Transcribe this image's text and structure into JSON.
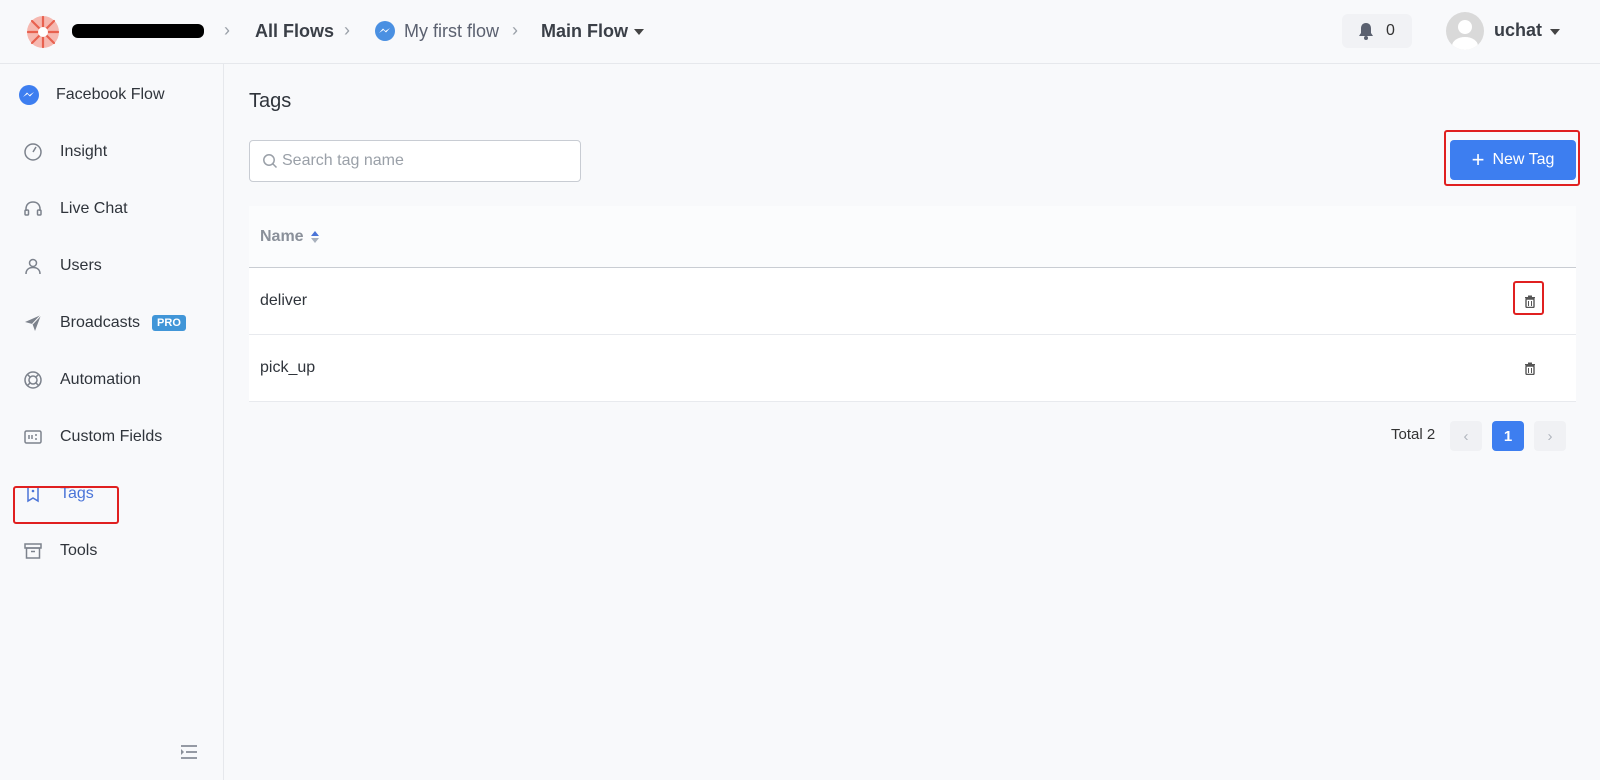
{
  "header": {
    "breadcrumbs": [
      "All Flows",
      "My first flow",
      "Main Flow"
    ],
    "notification_count": "0",
    "username": "uchat"
  },
  "sidebar": {
    "items": [
      {
        "label": "Facebook Flow",
        "icon": "messenger-icon"
      },
      {
        "label": "Insight",
        "icon": "gauge-icon"
      },
      {
        "label": "Live Chat",
        "icon": "headset-icon"
      },
      {
        "label": "Users",
        "icon": "user-icon"
      },
      {
        "label": "Broadcasts",
        "icon": "paper-plane-icon",
        "badge": "PRO"
      },
      {
        "label": "Automation",
        "icon": "lifebuoy-icon"
      },
      {
        "label": "Custom Fields",
        "icon": "fields-icon"
      },
      {
        "label": "Tags",
        "icon": "tag-icon",
        "active": true
      },
      {
        "label": "Tools",
        "icon": "archive-icon"
      }
    ]
  },
  "main": {
    "title": "Tags",
    "search_placeholder": "Search tag name",
    "new_tag_label": "New Tag",
    "table": {
      "columns": [
        "Name"
      ],
      "rows": [
        {
          "name": "deliver"
        },
        {
          "name": "pick_up"
        }
      ]
    },
    "pagination": {
      "total_label": "Total 2",
      "current_page": "1"
    }
  },
  "colors": {
    "accent": "#3d7ef0",
    "active_nav": "#4a74d8",
    "highlight": "#e02020",
    "pro_badge": "#4196d8"
  }
}
